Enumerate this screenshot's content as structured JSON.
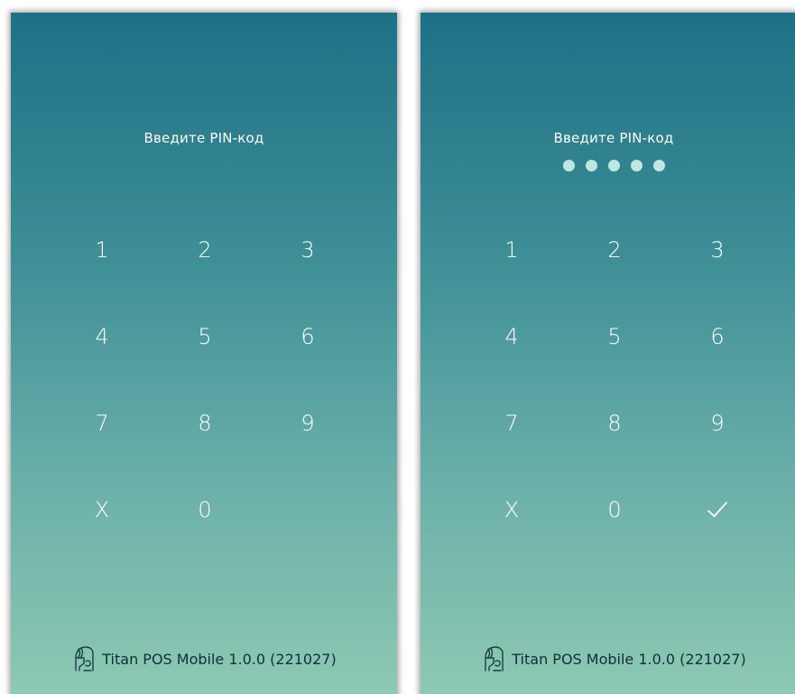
{
  "colors": {
    "gradient_top": "#1e7086",
    "gradient_bottom": "#8ecab3",
    "text": "#ffffff",
    "footer_text": "#0f2f3a",
    "pin_dot": "#bfe6df"
  },
  "screens": [
    {
      "state": "empty",
      "prompt": "Введите PIN-код",
      "pin_dots_filled": 0,
      "keys": [
        "1",
        "2",
        "3",
        "4",
        "5",
        "6",
        "7",
        "8",
        "9",
        "X",
        "0",
        ""
      ],
      "confirm_visible": false,
      "footer": {
        "logo_icon": "titan-helmet-logo-icon",
        "app_label": "Titan POS Mobile 1.0.0 (221027)"
      }
    },
    {
      "state": "filled",
      "prompt": "Введите PIN-код",
      "pin_dots_filled": 5,
      "keys": [
        "1",
        "2",
        "3",
        "4",
        "5",
        "6",
        "7",
        "8",
        "9",
        "X",
        "0"
      ],
      "confirm_visible": true,
      "confirm_icon": "checkmark-icon",
      "footer": {
        "logo_icon": "titan-helmet-logo-icon",
        "app_label": "Titan POS Mobile 1.0.0 (221027)"
      }
    }
  ]
}
